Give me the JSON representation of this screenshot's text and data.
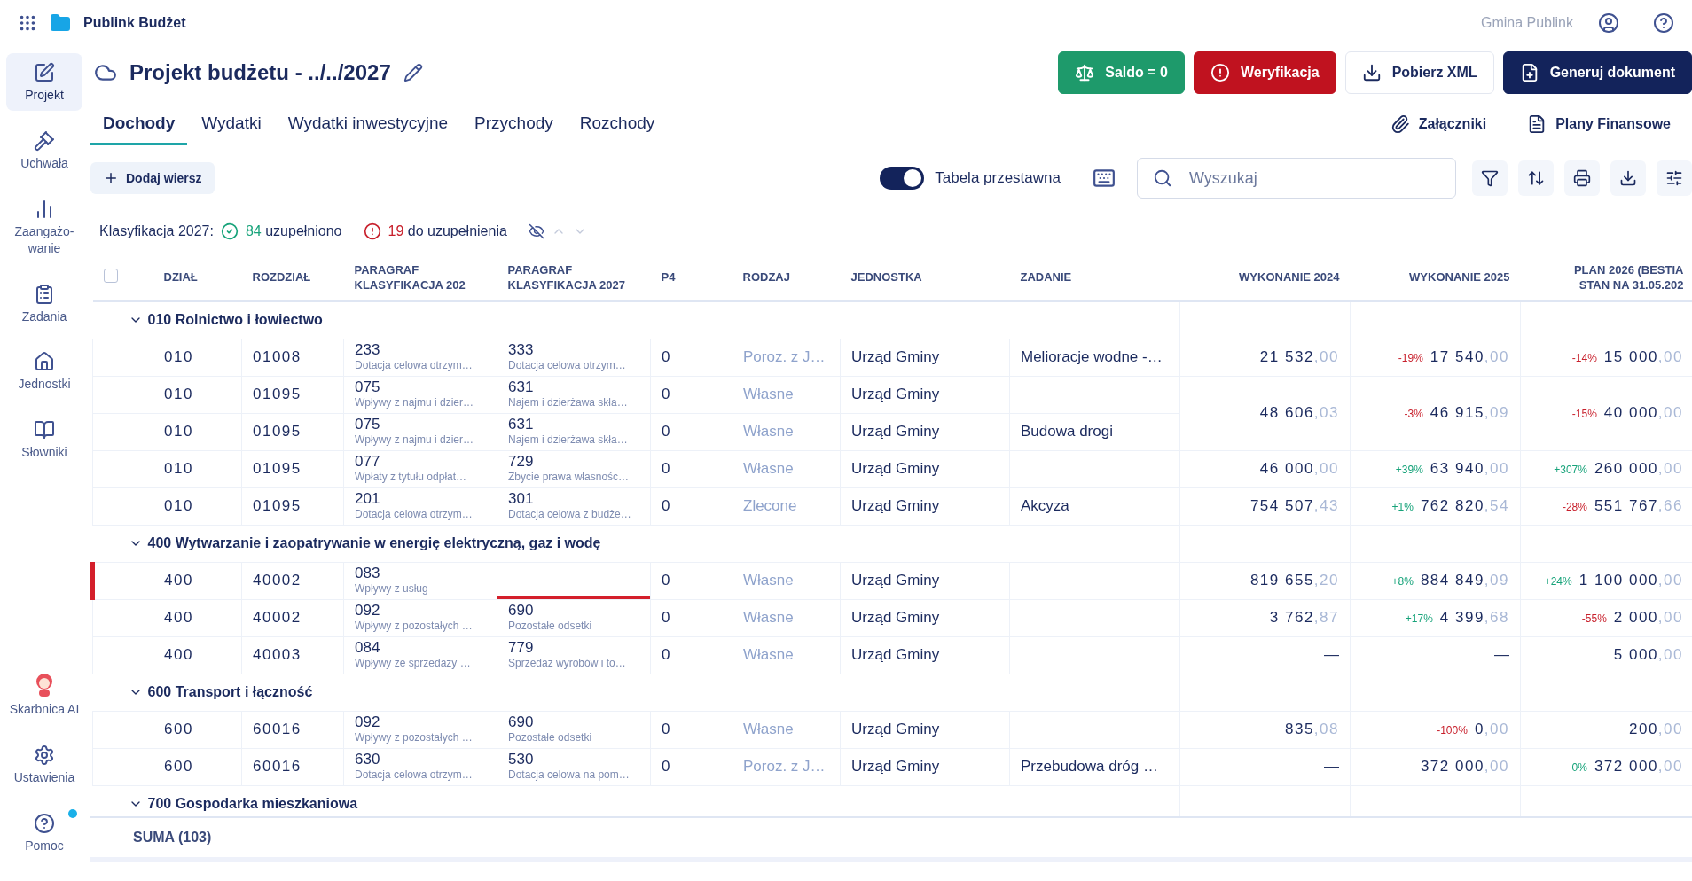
{
  "app": {
    "name": "Publink Budżet",
    "org": "Gmina Publink"
  },
  "sidebar": {
    "items": [
      {
        "label": "Projekt",
        "kind": "edit",
        "selected": true
      },
      {
        "label": "Uchwała",
        "kind": "gavel",
        "selected": false
      },
      {
        "label": "Zaangażo-\nwanie",
        "kind": "chart",
        "selected": false
      },
      {
        "label": "Zadania",
        "kind": "clipboard",
        "selected": false
      },
      {
        "label": "Jednostki",
        "kind": "buildings",
        "selected": false
      },
      {
        "label": "Słowniki",
        "kind": "book",
        "selected": false
      }
    ],
    "bottom_items": [
      {
        "label": "Skarbnica AI",
        "kind": "ai",
        "badge": false
      },
      {
        "label": "Ustawienia",
        "kind": "settings",
        "badge": false
      },
      {
        "label": "Pomoc",
        "kind": "help",
        "badge": true
      }
    ]
  },
  "header": {
    "title": "Projekt budżetu - ../../2027",
    "actions": [
      {
        "label": "Saldo = 0",
        "kind": "success"
      },
      {
        "label": "Weryfikacja",
        "kind": "danger"
      },
      {
        "label": "Pobierz XML",
        "kind": "outline"
      },
      {
        "label": "Generuj dokument",
        "kind": "primary"
      }
    ]
  },
  "tabs": [
    {
      "label": "Dochody",
      "selected": true
    },
    {
      "label": "Wydatki",
      "selected": false
    },
    {
      "label": "Wydatki inwestycyjne",
      "selected": false
    },
    {
      "label": "Przychody",
      "selected": false
    },
    {
      "label": "Rozchody",
      "selected": false
    }
  ],
  "links": [
    {
      "label": "Załączniki",
      "kind": "attach"
    },
    {
      "label": "Plany Finansowe",
      "kind": "plans"
    }
  ],
  "toolbar": {
    "add_button": "Dodaj wiersz",
    "pivot_toggle": {
      "label": "Tabela przestawna",
      "on": true
    },
    "search": {
      "placeholder": "Wyszukaj"
    }
  },
  "status": {
    "label": "Klasyfikacja 2027:",
    "done_count": "84",
    "done_label": "uzupełniono",
    "todo_count": "19",
    "todo_label": "do uzupełnienia"
  },
  "table": {
    "select_all": {
      "checked": false
    },
    "columns": [
      "DZIAŁ",
      "ROZDZIAŁ",
      "PARAGRAF\nKLASYFIKACJA 202",
      "PARAGRAF\nKLASYFIKACJA 2027",
      "P4",
      "RODZAJ",
      "JEDNOSTKA",
      "ZADANIE",
      "WYKONANIE 2024",
      "WYKONANIE 2025",
      "PLAN 2026 (BESTIA\nSTAN NA 31.05.202"
    ],
    "groups": [
      {
        "title": "010 Rolnictwo i łowiectwo",
        "expanded": true,
        "rows": [
          {
            "dzial": "010",
            "rozdzial": "01008",
            "par2026": {
              "code": "233",
              "desc": "Dotacja celowa otrzym…"
            },
            "par2027": {
              "code": "333",
              "desc": "Dotacja celowa otrzym…"
            },
            "p4": "0",
            "rodzaj": "Poroz. z J…",
            "jednostka": "Urząd Gminy",
            "zadanie": "Melioracje wodne -…",
            "error": false,
            "amounts_span_next": false,
            "amounts": [
              {
                "int": "21 532",
                "dec": ",00"
              },
              {
                "change": {
                  "text": "-19%",
                  "color": "#c8202c"
                },
                "int": "17 540",
                "dec": ",00"
              },
              {
                "change": {
                  "text": "-14%",
                  "color": "#c8202c"
                },
                "int": "15 000",
                "dec": ",00"
              }
            ]
          },
          {
            "dzial": "010",
            "rozdzial": "01095",
            "par2026": {
              "code": "075",
              "desc": "Wpływy z najmu i dzier…"
            },
            "par2027": {
              "code": "631",
              "desc": "Najem i dzierżawa skła…"
            },
            "p4": "0",
            "rodzaj": "Własne",
            "jednostka": "Urząd Gminy",
            "error": false,
            "amounts_span_next": true,
            "amounts": [
              {
                "int": "48 606",
                "dec": ",03"
              },
              {
                "change": {
                  "text": "-3%",
                  "color": "#c8202c"
                },
                "int": "46 915",
                "dec": ",09"
              },
              {
                "change": {
                  "text": "-15%",
                  "color": "#c8202c"
                },
                "int": "40 000",
                "dec": ",00"
              }
            ]
          },
          {
            "dzial": "010",
            "rozdzial": "01095",
            "par2026": {
              "code": "075",
              "desc": "Wpływy z najmu i dzier…"
            },
            "par2027": {
              "code": "631",
              "desc": "Najem i dzierżawa skła…"
            },
            "p4": "0",
            "rodzaj": "Własne",
            "jednostka": "Urząd Gminy",
            "zadanie": "Budowa drogi",
            "error": false,
            "amounts_span_next": false
          },
          {
            "dzial": "010",
            "rozdzial": "01095",
            "par2026": {
              "code": "077",
              "desc": "Wpłaty z tytułu odpłat…"
            },
            "par2027": {
              "code": "729",
              "desc": "Zbycie prawa własnośc…"
            },
            "p4": "0",
            "rodzaj": "Własne",
            "jednostka": "Urząd Gminy",
            "error": false,
            "amounts_span_next": false,
            "amounts": [
              {
                "int": "46 000",
                "dec": ",00"
              },
              {
                "change": {
                  "text": "+39%",
                  "color": "#17a37a"
                },
                "int": "63 940",
                "dec": ",00"
              },
              {
                "change": {
                  "text": "+307%",
                  "color": "#17a37a"
                },
                "int": "260 000",
                "dec": ",00"
              }
            ]
          },
          {
            "dzial": "010",
            "rozdzial": "01095",
            "par2026": {
              "code": "201",
              "desc": "Dotacja celowa otrzym…"
            },
            "par2027": {
              "code": "301",
              "desc": "Dotacja celowa z budże…"
            },
            "p4": "0",
            "rodzaj": "Zlecone",
            "jednostka": "Urząd Gminy",
            "zadanie": "Akcyza",
            "error": false,
            "amounts_span_next": false,
            "amounts": [
              {
                "int": "754 507",
                "dec": ",43"
              },
              {
                "change": {
                  "text": "+1%",
                  "color": "#17a37a"
                },
                "int": "762 820",
                "dec": ",54"
              },
              {
                "change": {
                  "text": "-28%",
                  "color": "#c8202c"
                },
                "int": "551 767",
                "dec": ",66"
              }
            ]
          }
        ]
      },
      {
        "title": "400 Wytwarzanie i zaopatrywanie w energię elektryczną, gaz i wodę",
        "expanded": true,
        "rows": [
          {
            "dzial": "400",
            "rozdzial": "40002",
            "par2026": {
              "code": "083",
              "desc": "Wpływy z usług"
            },
            "p4": "0",
            "rodzaj": "Własne",
            "jednostka": "Urząd Gminy",
            "error": true,
            "amounts_span_next": false,
            "amounts": [
              {
                "int": "819 655",
                "dec": ",20"
              },
              {
                "change": {
                  "text": "+8%",
                  "color": "#17a37a"
                },
                "int": "884 849",
                "dec": ",09"
              },
              {
                "change": {
                  "text": "+24%",
                  "color": "#17a37a"
                },
                "int": "1 100 000",
                "dec": ",00"
              }
            ]
          },
          {
            "dzial": "400",
            "rozdzial": "40002",
            "par2026": {
              "code": "092",
              "desc": "Wpływy z pozostałych …"
            },
            "par2027": {
              "code": "690",
              "desc": "Pozostałe odsetki"
            },
            "p4": "0",
            "rodzaj": "Własne",
            "jednostka": "Urząd Gminy",
            "error": false,
            "amounts_span_next": false,
            "amounts": [
              {
                "int": "3 762",
                "dec": ",87"
              },
              {
                "change": {
                  "text": "+17%",
                  "color": "#17a37a"
                },
                "int": "4 399",
                "dec": ",68"
              },
              {
                "change": {
                  "text": "-55%",
                  "color": "#c8202c"
                },
                "int": "2 000",
                "dec": ",00"
              }
            ]
          },
          {
            "dzial": "400",
            "rozdzial": "40003",
            "par2026": {
              "code": "084",
              "desc": "Wpływy ze sprzedaży …"
            },
            "par2027": {
              "code": "779",
              "desc": "Sprzedaż wyrobów i to…"
            },
            "p4": "0",
            "rodzaj": "Własne",
            "jednostka": "Urząd Gminy",
            "error": false,
            "amounts_span_next": false,
            "amounts": [
              {
                "dash": "—"
              },
              {
                "dash": "—"
              },
              {
                "int": "5 000",
                "dec": ",00"
              }
            ]
          }
        ]
      },
      {
        "title": "600 Transport i łączność",
        "expanded": true,
        "rows": [
          {
            "dzial": "600",
            "rozdzial": "60016",
            "par2026": {
              "code": "092",
              "desc": "Wpływy z pozostałych …"
            },
            "par2027": {
              "code": "690",
              "desc": "Pozostałe odsetki"
            },
            "p4": "0",
            "rodzaj": "Własne",
            "jednostka": "Urząd Gminy",
            "error": false,
            "amounts_span_next": false,
            "amounts": [
              {
                "int": "835",
                "dec": ",08"
              },
              {
                "change": {
                  "text": "-100%",
                  "color": "#c8202c"
                },
                "int": "0",
                "dec": ",00"
              },
              {
                "int": "200",
                "dec": ",00"
              }
            ]
          },
          {
            "dzial": "600",
            "rozdzial": "60016",
            "par2026": {
              "code": "630",
              "desc": "Dotacja celowa otrzym…"
            },
            "par2027": {
              "code": "530",
              "desc": "Dotacja celowa na pom…"
            },
            "p4": "0",
            "rodzaj": "Poroz. z J…",
            "jednostka": "Urząd Gminy",
            "zadanie": "Przebudowa dróg …",
            "error": false,
            "amounts_span_next": false,
            "amounts": [
              {
                "dash": "—"
              },
              {
                "int": "372 000",
                "dec": ",00"
              },
              {
                "change": {
                  "text": "0%",
                  "color": "#17a37a"
                },
                "int": "372 000",
                "dec": ",00"
              }
            ]
          }
        ]
      },
      {
        "title": "700 Gospodarka mieszkaniowa",
        "expanded": true
      }
    ],
    "footer": "SUMA (103)"
  }
}
